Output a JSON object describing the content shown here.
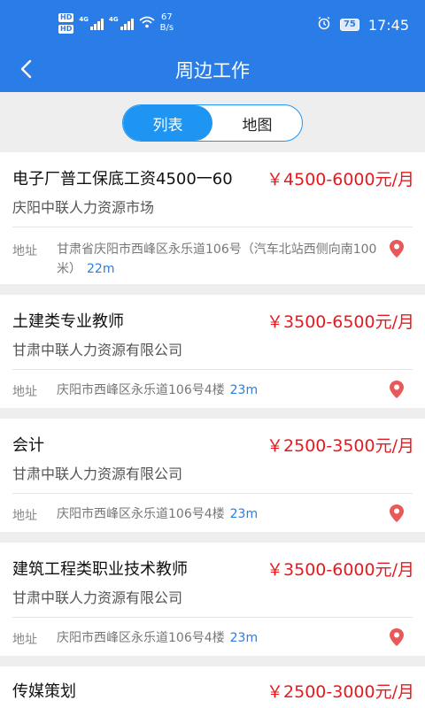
{
  "status_bar": {
    "hd1": "HD",
    "hd2": "HD",
    "net1": "4G",
    "net2": "4G",
    "speed_value": "67",
    "speed_unit": "B/s",
    "battery": "75",
    "time": "17:45"
  },
  "header": {
    "title": "周边工作"
  },
  "tabs": {
    "list": "列表",
    "map": "地图",
    "selected": "list"
  },
  "address_label": "地址",
  "jobs": [
    {
      "title": "电子厂普工保底工资4500一60",
      "salary": "￥4500-6000元/月",
      "company": "庆阳中联人力资源市场",
      "address": "甘肃省庆阳市西峰区永乐道106号（汽车北站西侧向南100米）",
      "distance": "22m"
    },
    {
      "title": "土建类专业教师",
      "salary": "￥3500-6500元/月",
      "company": "甘肃中联人力资源有限公司",
      "address": "庆阳市西峰区永乐道106号4楼",
      "distance": "23m"
    },
    {
      "title": "会计",
      "salary": "￥2500-3500元/月",
      "company": "甘肃中联人力资源有限公司",
      "address": "庆阳市西峰区永乐道106号4楼",
      "distance": "23m"
    },
    {
      "title": "建筑工程类职业技术教师",
      "salary": "￥3500-6000元/月",
      "company": "甘肃中联人力资源有限公司",
      "address": "庆阳市西峰区永乐道106号4楼",
      "distance": "23m"
    },
    {
      "title": "传媒策划",
      "salary": "￥2500-3000元/月",
      "company": "",
      "address": "",
      "distance": ""
    }
  ],
  "colors": {
    "header": "#2a7ce6",
    "tab_active": "#1e95f2",
    "salary": "#e8191e",
    "pin": "#e85a5a",
    "distance": "#2a7ce6"
  }
}
